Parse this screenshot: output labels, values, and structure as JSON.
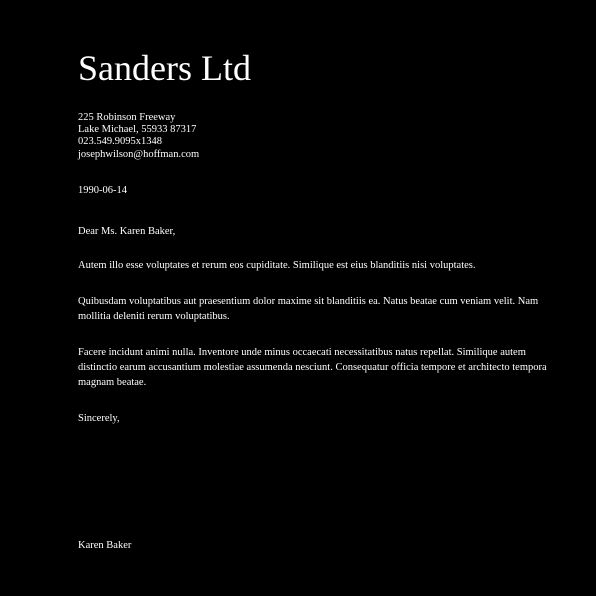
{
  "letter": {
    "company": "Sanders Ltd",
    "address": {
      "street": "225 Robinson Freeway",
      "city_line": "Lake Michael, 55933 87317",
      "phone": "023.549.9095x1348",
      "email": "josephwilson@hoffman.com"
    },
    "date": "1990-06-14",
    "salutation": "Dear Ms. Karen Baker,",
    "paragraphs": [
      "Autem illo esse voluptates et rerum eos cupiditate. Similique est eius blanditiis nisi voluptates.",
      "Quibusdam voluptatibus aut praesentium dolor maxime sit blanditiis ea. Natus beatae cum veniam velit. Nam mollitia deleniti rerum voluptatibus.",
      "Facere incidunt animi nulla. Inventore unde minus occaecati necessitatibus natus repellat. Similique autem distinctio earum accusantium molestiae assumenda nesciunt. Consequatur officia tempore et architecto tempora magnam beatae."
    ],
    "closing": "Sincerely,",
    "signature": "Karen Baker"
  }
}
